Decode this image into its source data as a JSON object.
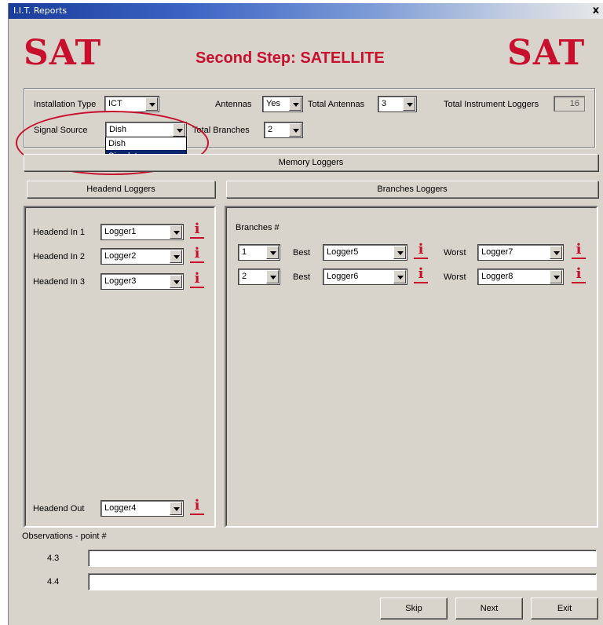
{
  "window": {
    "title": "I.I.T. Reports",
    "close_label": "x"
  },
  "logos": {
    "left": "SAT",
    "right": "SAT"
  },
  "step_title": "Second Step: SATELLITE",
  "config": {
    "installation_type": {
      "label": "Installation Type",
      "value": "ICT"
    },
    "antennas": {
      "label": "Antennas",
      "value": "Yes"
    },
    "total_antennas": {
      "label": "Total Antennas",
      "value": "3"
    },
    "total_instrument_loggers": {
      "label": "Total Instrument Loggers",
      "value": "16"
    },
    "signal_source": {
      "label": "Signal Source",
      "value": "Dish",
      "options": [
        "Dish",
        "Simulator"
      ],
      "highlighted": "Simulator"
    },
    "total_branches": {
      "label": "Total Branches",
      "value": "2"
    }
  },
  "sections": {
    "memory_loggers": "Memory Loggers",
    "headend_loggers": "Headend Loggers",
    "branches_loggers": "Branches Loggers"
  },
  "headend": {
    "rows": [
      {
        "label": "Headend In 1",
        "value": "Logger1"
      },
      {
        "label": "Headend In 2",
        "value": "Logger2"
      },
      {
        "label": "Headend In 3",
        "value": "Logger3"
      }
    ],
    "out": {
      "label": "Headend Out",
      "value": "Logger4"
    }
  },
  "branches": {
    "header": "Branches #",
    "best_label": "Best",
    "worst_label": "Worst",
    "rows": [
      {
        "num": "1",
        "best": "Logger5",
        "worst": "Logger7"
      },
      {
        "num": "2",
        "best": "Logger6",
        "worst": "Logger8"
      }
    ]
  },
  "info_glyph": "i",
  "observations": {
    "title": "Observations - point #",
    "rows": [
      {
        "label": "4.3",
        "value": ""
      },
      {
        "label": "4.4",
        "value": ""
      }
    ]
  },
  "buttons": {
    "skip": "Skip",
    "next": "Next",
    "exit": "Exit"
  },
  "colors": {
    "accent_red": "#c8102e",
    "face": "#d8d4cc",
    "selection": "#0a246a"
  }
}
